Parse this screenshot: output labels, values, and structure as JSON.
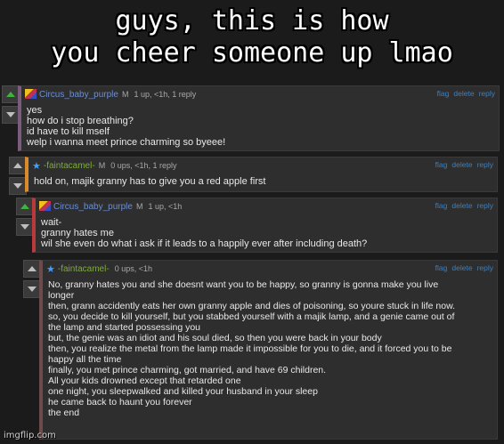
{
  "caption": {
    "line1": "guys, this is how",
    "line2": "you cheer someone up lmao"
  },
  "colors": {
    "accent_purple": "#7b5c7b",
    "accent_orange": "#d98a2b",
    "accent_red": "#b83a3a",
    "accent_brown": "#6e4a4a",
    "link_blue": "#3d7fbf",
    "upvote_green": "#3fb33f"
  },
  "comments": [
    {
      "user": "Circus_baby_purple",
      "rank": "M",
      "meta": "1 up, <1h, 1 reply",
      "avatar": "user-avatar-icon",
      "lines": [
        "yes",
        "how do i stop breathing?",
        "id have to kill mself",
        "welp i wanna meet prince charming so byeee!"
      ]
    },
    {
      "user": "-faintacamel-",
      "rank": "M",
      "meta": "0 ups, <1h, 1 reply",
      "avatar": "star-icon",
      "lines": [
        "hold on, majik granny has to give you a red apple first"
      ]
    },
    {
      "user": "Circus_baby_purple",
      "rank": "M",
      "meta": "1 up, <1h",
      "avatar": "user-avatar-icon",
      "lines": [
        "wait-",
        "granny hates me",
        "wil she even do what i ask if it leads to a happily ever after including death?"
      ]
    },
    {
      "user": "-faintacamel-",
      "rank": "",
      "meta": "0 ups, <1h",
      "avatar": "star-icon",
      "lines": [
        "No, granny hates you and she doesnt want you to be happy, so granny is gonna make you live",
        "longer",
        "then, grann accidently eats her own granny apple and dies of poisoning, so youre stuck in life now.",
        "so, you decide to kill yourself, but you stabbed yourself with a majik lamp, and a genie came out of",
        "the lamp and started possessing you",
        "but, the genie was an idiot and his soul died, so then you were back in your body",
        "then, you realize the metal from the lamp made it impossible for you to die, and it forced you to be",
        "happy all the time",
        "finally, you met prince charming, got married, and have 69 children.",
        "All your kids drowned except that retarded one",
        "one night, you sleepwalked and killed your husband in your sleep",
        "he came back to haunt you forever",
        "the end"
      ]
    }
  ],
  "actions": {
    "flag": "flag",
    "delete": "delete",
    "reply": "reply"
  },
  "watermark": "imgflip.com"
}
